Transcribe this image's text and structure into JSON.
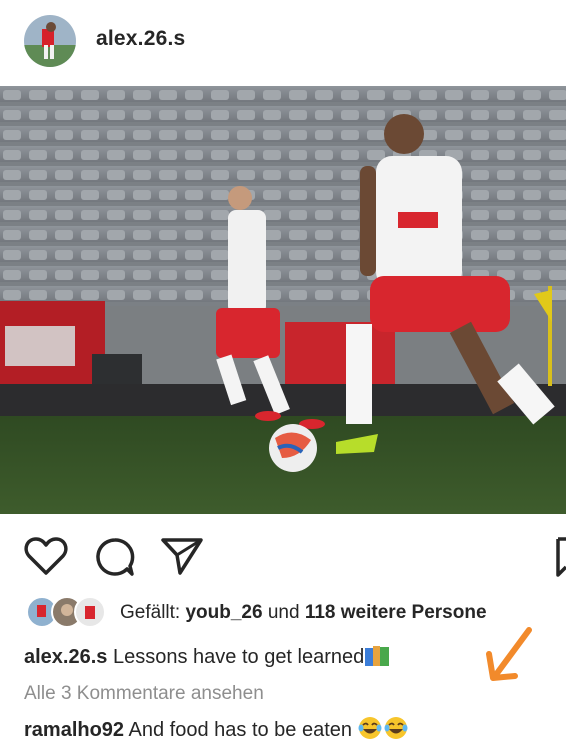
{
  "post": {
    "username": "alex.26.s"
  },
  "likes": {
    "prefix": "Gefällt: ",
    "first_liker": "youb_26",
    "connector": " und ",
    "others": "118 weitere Persone"
  },
  "caption": {
    "username": "alex.26.s",
    "text": " Lessons have to get learned"
  },
  "comments": {
    "view_all": "Alle 3 Kommentare ansehen",
    "items": [
      {
        "username": "ramalho92",
        "text": " And food has to be eaten "
      }
    ]
  },
  "icons": {
    "like": "heart-icon",
    "comment": "comment-bubble-icon",
    "share": "paper-plane-icon",
    "save": "bookmark-icon"
  },
  "colors": {
    "text": "#262626",
    "muted": "#8e8e8e",
    "annotation_arrow": "#f28a2b",
    "jersey_red": "#d8262e"
  }
}
